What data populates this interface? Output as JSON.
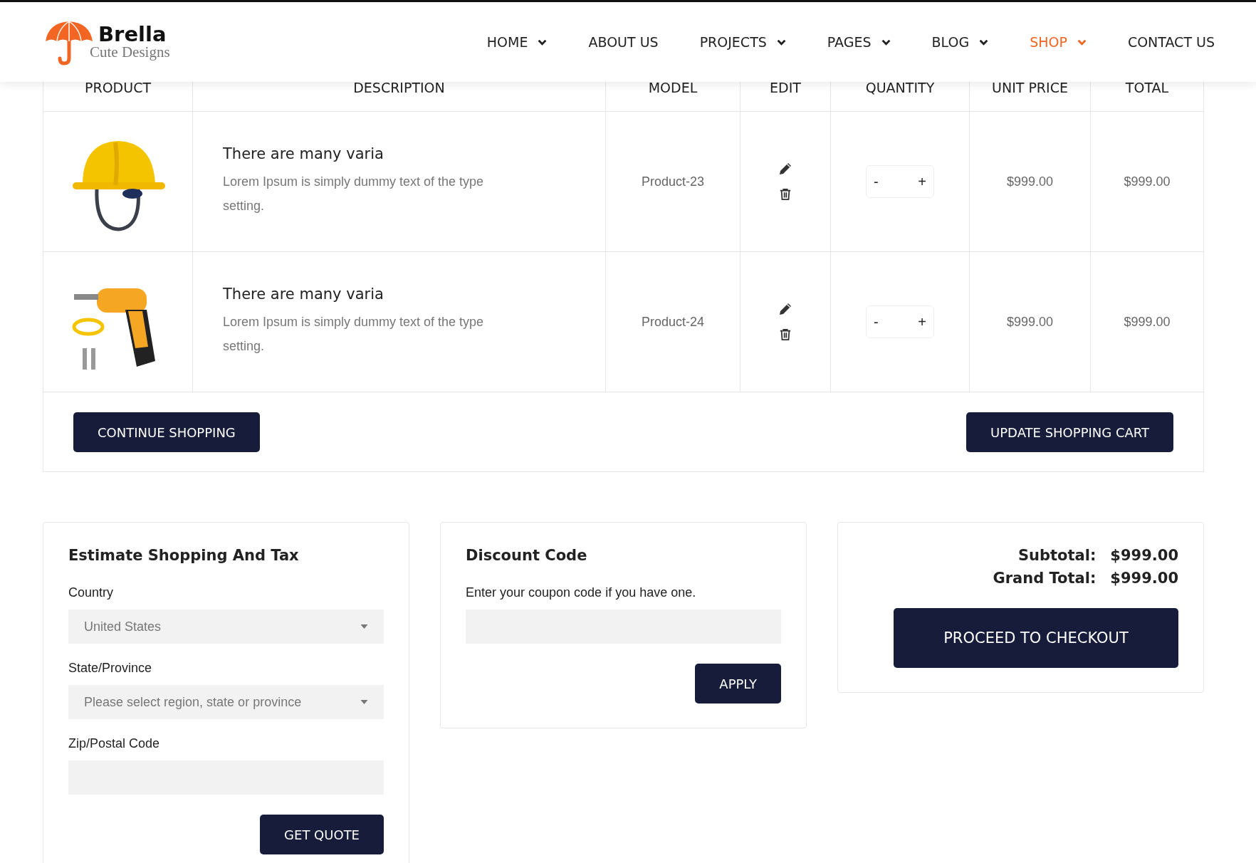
{
  "nav": {
    "logo": {
      "name": "Brella",
      "tagline": "Cute Designs"
    },
    "items": [
      {
        "label": "HOME",
        "has_menu": true,
        "selected": false
      },
      {
        "label": "ABOUT US",
        "has_menu": false,
        "selected": false
      },
      {
        "label": "PROJECTS",
        "has_menu": true,
        "selected": false
      },
      {
        "label": "PAGES",
        "has_menu": true,
        "selected": false
      },
      {
        "label": "BLOG",
        "has_menu": true,
        "selected": false
      },
      {
        "label": "SHOP",
        "has_menu": true,
        "selected": true
      },
      {
        "label": "CONTACT US",
        "has_menu": false,
        "selected": false
      }
    ]
  },
  "cart": {
    "columns": [
      "PRODUCT",
      "DESCRIPTION",
      "MODEL",
      "EDIT",
      "QUANTITY",
      "UNIT PRICE",
      "TOTAL"
    ],
    "rows": [
      {
        "title": "There are many varia",
        "description": "Lorem Ipsum is simply dummy text of the type setting.",
        "model": "Product-23",
        "minus": "-",
        "plus": "+",
        "unit_price": "$999.00",
        "total": "$999.00"
      },
      {
        "title": "There are many varia",
        "description": "Lorem Ipsum is simply dummy text of the type setting.",
        "model": "Product-24",
        "minus": "-",
        "plus": "+",
        "unit_price": "$999.00",
        "total": "$999.00"
      }
    ],
    "buttons": [
      "CONTINUE SHOPPING",
      "UPDATE SHOPPING CART"
    ]
  },
  "estimate": {
    "title": "Estimate Shopping And Tax",
    "fields": [
      {
        "label": "Country",
        "kind": "select",
        "value": "United States"
      },
      {
        "label": "State/Province",
        "kind": "select",
        "value": "Please select region, state or province"
      },
      {
        "label": "Zip/Postal Code",
        "kind": "input"
      }
    ],
    "button": "GET QUOTE"
  },
  "discount": {
    "title": "Discount Code",
    "text": "Enter your coupon code if you have one.",
    "button": "APPLY"
  },
  "totals": {
    "rows": [
      {
        "label": "Subtotal:",
        "value": "$999.00"
      },
      {
        "label": "Grand Total:",
        "value": "$999.00"
      }
    ],
    "button": "PROCEED TO CHECKOUT"
  }
}
